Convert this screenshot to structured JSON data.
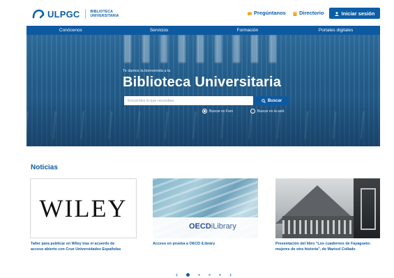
{
  "brand": {
    "name": "ULPGC",
    "sub_line1": "BIBLIOTECA",
    "sub_line2": "UNIVERSITARIA",
    "color": "#0d5ea6"
  },
  "header": {
    "ask_label": "Pregúntanos",
    "ask_icon": "chat-icon",
    "directory_label": "Directorio",
    "directory_icon": "book-icon",
    "login_label": "Iniciar sesión",
    "login_icon": "user-icon"
  },
  "nav": {
    "items": [
      {
        "label": "Conócenos"
      },
      {
        "label": "Servicios"
      },
      {
        "label": "Formación"
      },
      {
        "label": "Portales digitales"
      }
    ]
  },
  "hero": {
    "welcome": "Te damos la bienvenida a la",
    "title": "Biblioteca Universitaria",
    "search_placeholder": "Encuentra lo que necesitas",
    "search_button": "Buscar",
    "option_faro": "Buscar en Faro",
    "option_web": "Buscar en la web",
    "selected_option": "faro"
  },
  "news": {
    "title": "Noticias",
    "cards": [
      {
        "image_text": "WILEY",
        "caption_line1": "Taller para publicar en Wiley tras el acuerdo de",
        "caption_line2": "acceso abierto con Crue Universidades Españolas"
      },
      {
        "image_text_1": "OECD",
        "image_text_2": "iLibrary",
        "caption_line1": "Acceso en prueba a OECD iLibrary",
        "caption_line2": ""
      },
      {
        "caption_line1": "Presentación del libro \"Los cuadernos de Fayagueto:",
        "caption_line2": "mujeres de otra historia\", de Marisol Collado"
      }
    ]
  },
  "pager": {
    "prev": "‹",
    "next": "›",
    "active_index": 0,
    "total": 4
  }
}
